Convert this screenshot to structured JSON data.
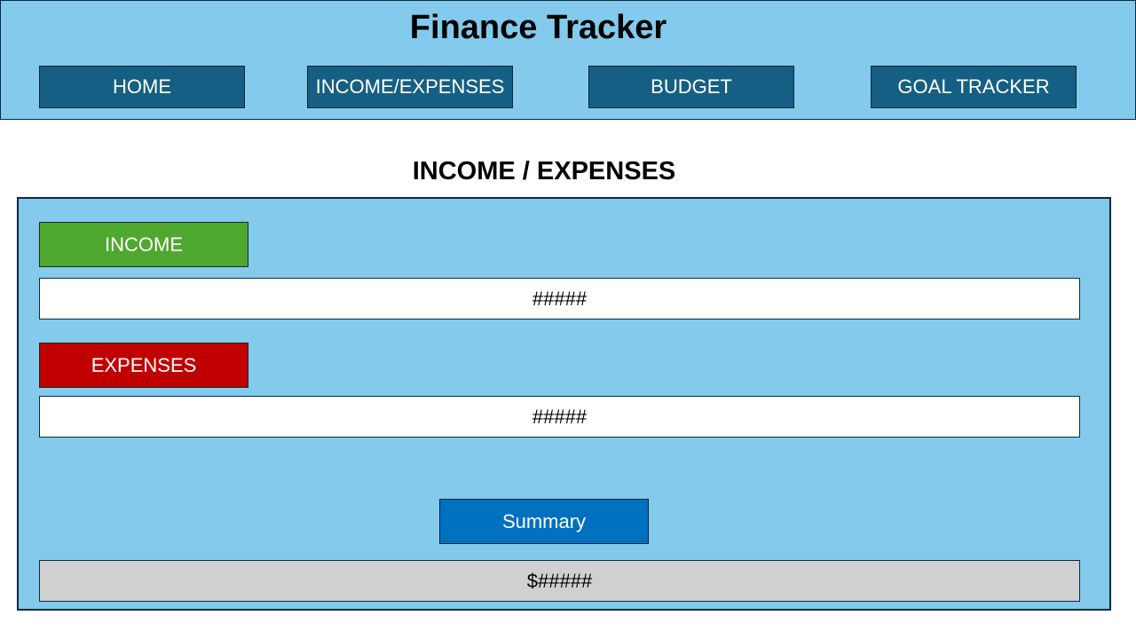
{
  "header": {
    "title": "Finance Tracker",
    "nav": {
      "home": "HOME",
      "income_expenses": "INCOME/EXPENSES",
      "budget": "BUDGET",
      "goal_tracker": "GOAL TRACKER"
    }
  },
  "main": {
    "section_title": "INCOME / EXPENSES",
    "income": {
      "label": "INCOME",
      "value": "#####"
    },
    "expenses": {
      "label": "EXPENSES",
      "value": "#####"
    },
    "summary": {
      "button_label": "Summary",
      "value": "$#####"
    }
  },
  "colors": {
    "header_bg": "#83caec",
    "nav_button": "#155f84",
    "income": "#4ea72e",
    "expenses": "#c00000",
    "summary_button": "#0070c0",
    "summary_field": "#d0d0d0"
  }
}
